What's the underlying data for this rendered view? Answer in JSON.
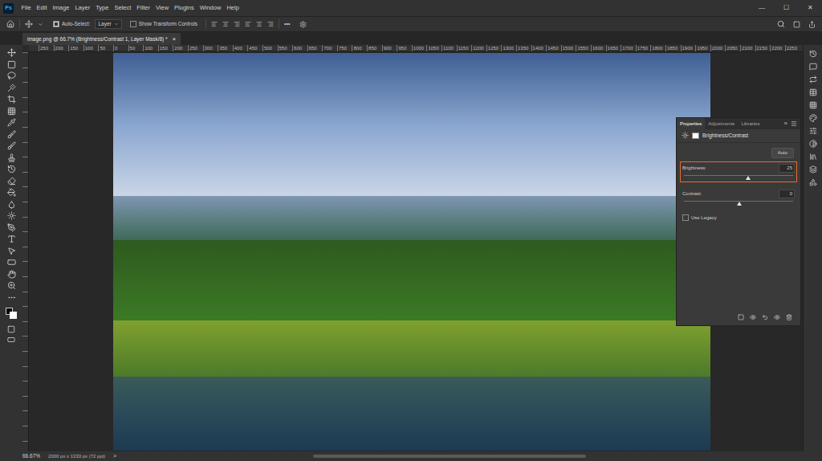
{
  "app": {
    "logo": "Ps"
  },
  "menu": [
    "File",
    "Edit",
    "Image",
    "Layer",
    "Type",
    "Select",
    "Filter",
    "View",
    "Plugins",
    "Window",
    "Help"
  ],
  "window_controls": [
    "—",
    "☐",
    "✕"
  ],
  "options_bar": {
    "auto_select": {
      "label": "Auto-Select:",
      "checked": true
    },
    "layer_dropdown": "Layer",
    "show_transform": {
      "label": "Show Transform Controls",
      "checked": false
    },
    "more": "•••"
  },
  "document_tab": {
    "title": "image.png @ 66.7% (Brightness/Contrast 1, Layer Mask/8) *",
    "close": "×",
    "selected": true
  },
  "ruler": {
    "labels": [
      "250",
      "200",
      "150",
      "100",
      "50",
      "0",
      "50",
      "100",
      "150",
      "200",
      "250",
      "300",
      "350",
      "400",
      "450",
      "500",
      "550",
      "600",
      "650",
      "700",
      "750",
      "800",
      "850",
      "900",
      "950",
      "1000",
      "1050",
      "1100",
      "1150",
      "1200",
      "1250",
      "1300",
      "1350",
      "1400",
      "1450",
      "1500",
      "1550",
      "1600",
      "1650",
      "1700",
      "1750",
      "1800",
      "1850",
      "1900",
      "1950",
      "2000",
      "2050",
      "2100",
      "2150",
      "2200",
      "2250"
    ]
  },
  "properties_panel": {
    "tabs": [
      {
        "label": "Properties",
        "selected": true
      },
      {
        "label": "Adjustments",
        "selected": false
      },
      {
        "label": "Libraries",
        "selected": false
      }
    ],
    "expand": "»",
    "title": "Brightness/Contrast",
    "auto_button": "Auto",
    "sliders": [
      {
        "label": "Brightness:",
        "value": "25",
        "level": 0.59,
        "highlighted": true
      },
      {
        "label": "Contrast:",
        "value": "0",
        "level": 0.51,
        "highlighted": false
      }
    ],
    "use_legacy": {
      "label": "Use Legacy",
      "checked": false
    }
  },
  "status_bar": {
    "zoom": "66.67%",
    "info": "2000 px x 1333 px (72 ppi)",
    "arrow": ">"
  }
}
